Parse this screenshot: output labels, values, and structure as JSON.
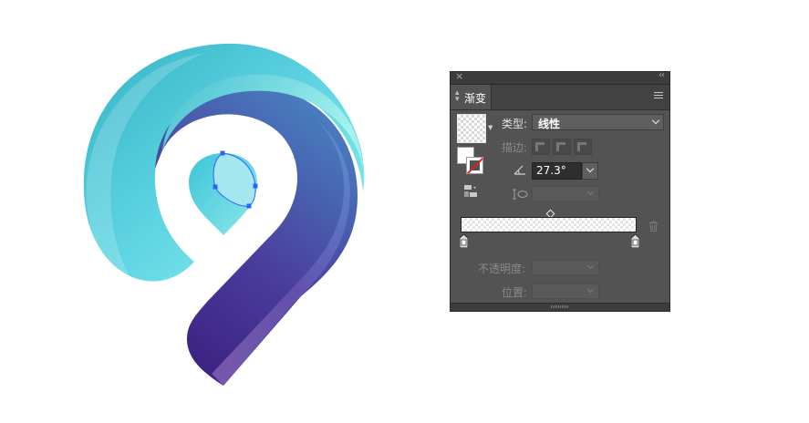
{
  "panel": {
    "close_glyph": "×",
    "collapse_glyph": "‹‹",
    "tab_label": "渐变",
    "type_label": "类型:",
    "type_value": "线性",
    "stroke_label": "描边:",
    "angle_value": "27.3°",
    "opacity_label": "不透明度:",
    "position_label": "位置:"
  },
  "icons": {
    "close": "close-icon",
    "collapse": "double-chevron-left-icon",
    "menu": "menu-icon",
    "angle": "angle-icon",
    "aspect": "aspect-ratio-icon",
    "trash": "trash-icon",
    "gradient_stop": "gradient-stop-icon"
  },
  "colors": {
    "panel_bg": "#535353",
    "logo_teal_light": "#86ecee",
    "logo_teal": "#4fc6d6",
    "logo_blue": "#3f6fb0",
    "logo_purple": "#4a2a8e",
    "selection_blue": "#2a63ff"
  }
}
